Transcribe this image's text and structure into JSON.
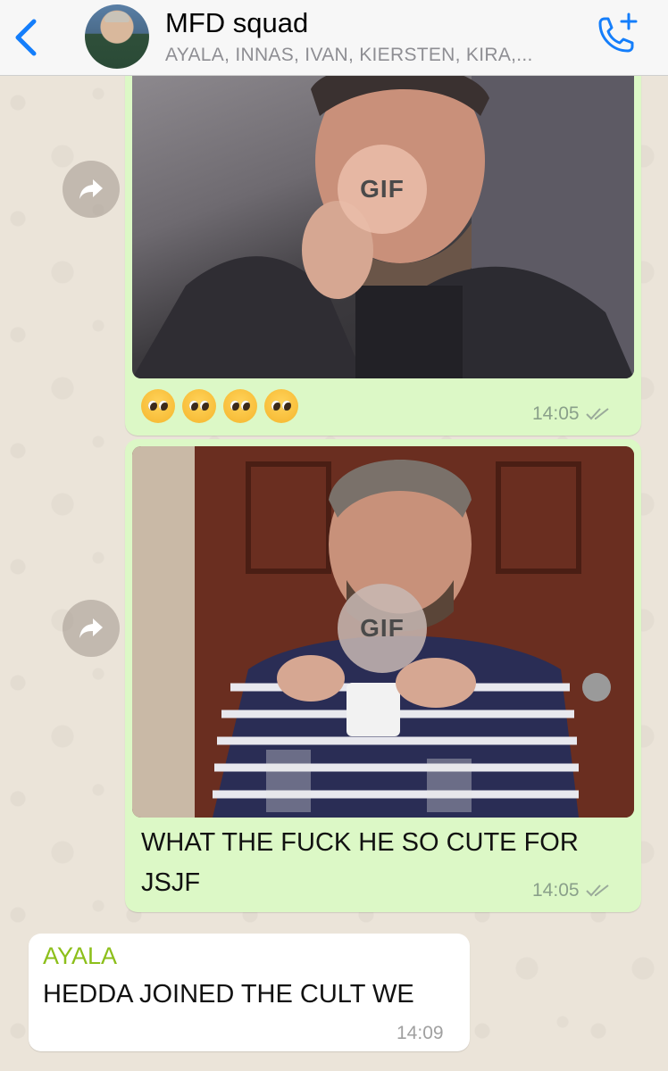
{
  "header": {
    "title": "MFD squad",
    "subtitle": "AYALA, INNAS, IVAN, KIERSTEN, KIRA,..."
  },
  "messages": [
    {
      "type": "gif",
      "gif_badge": "GIF",
      "caption_emoji": [
        "pleading-face",
        "pleading-face",
        "pleading-face",
        "pleading-face"
      ],
      "time": "14:05",
      "status": "double-check"
    },
    {
      "type": "gif",
      "gif_badge": "GIF",
      "caption_line1": "WHAT THE FUCK HE SO CUTE FOR",
      "caption_line2": "JSJF",
      "time": "14:05",
      "status": "double-check"
    },
    {
      "type": "text",
      "sender": "AYALA",
      "text": "HEDDA JOINED THE CULT WE",
      "time": "14:09"
    }
  ],
  "colors": {
    "outgoing_bubble": "#dcf8c6",
    "incoming_bubble": "#ffffff",
    "accent_blue": "#147efb",
    "sender_name": "#8cbf1a"
  }
}
